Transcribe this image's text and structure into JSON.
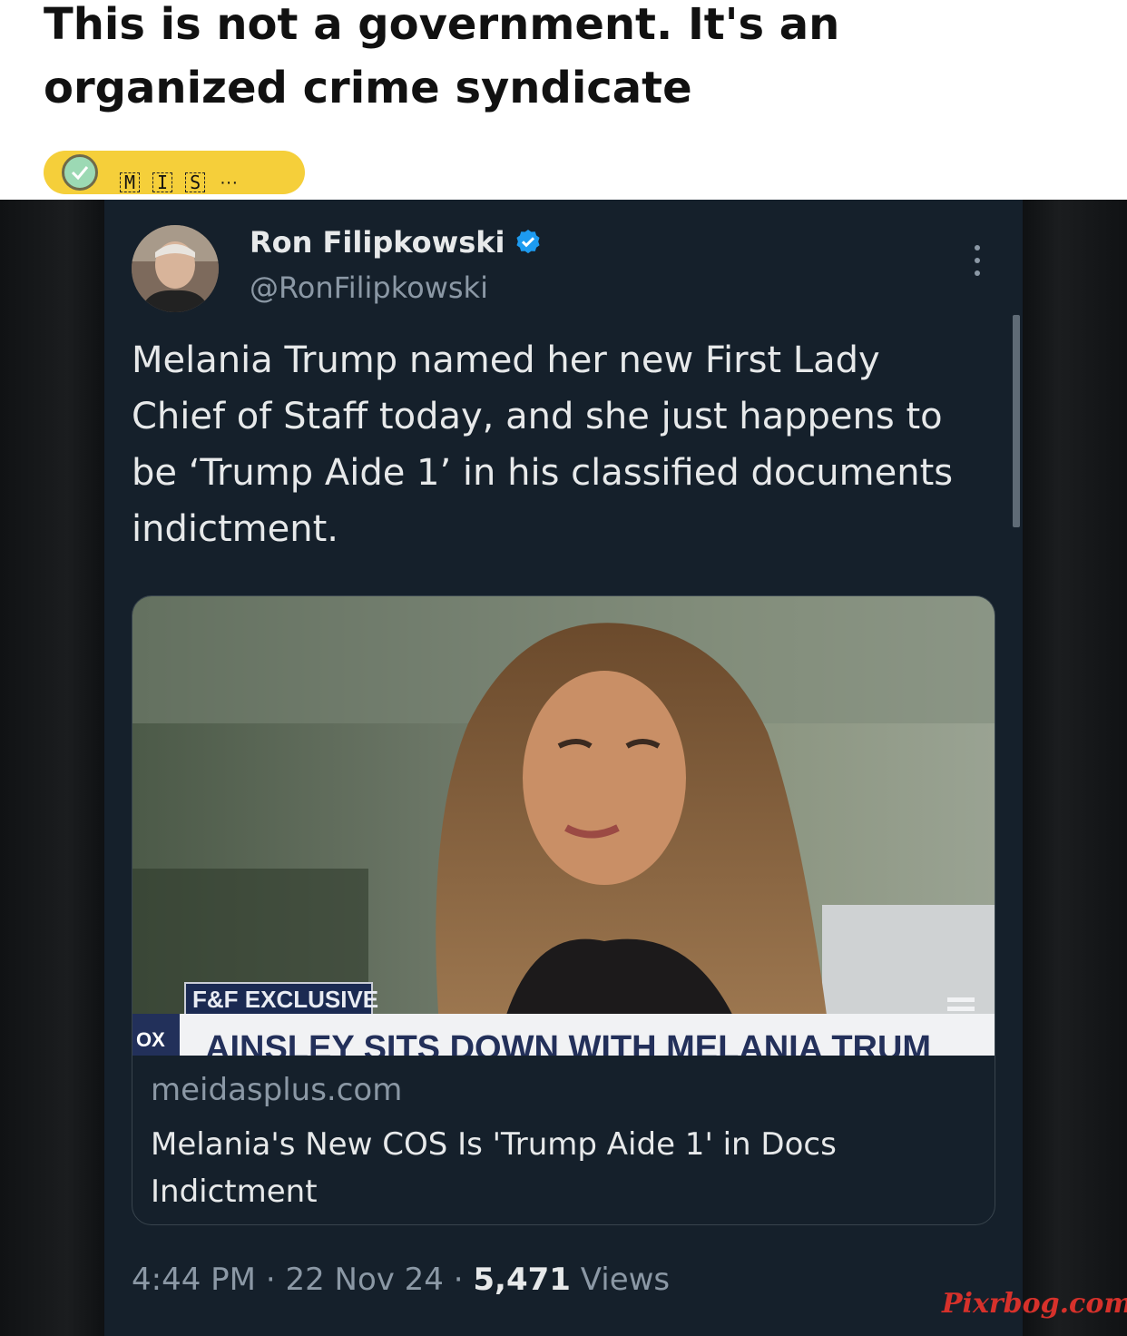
{
  "post": {
    "title": "This is not a government. It's an organized crime syndicate",
    "flair": {
      "letters": [
        "M",
        "I",
        "S"
      ],
      "more": "···",
      "icon": "check-circle-icon"
    }
  },
  "tweet": {
    "author_name": "Ron Filipkowski",
    "handle": "@RonFilipkowski",
    "verified_icon": "verified-badge-icon",
    "text": "Melania Trump named her new First Lady Chief of Staff today, and she just happens to be ‘Trump Aide 1’ in his classified documents indictment.",
    "media": {
      "banner_tag": "F&F EXCLUSIVE",
      "banner_headline": "AINSLEY SITS DOWN WITH MELANIA TRUM",
      "network_logo": "OX",
      "link_domain": "meidasplus.com",
      "link_title": "Melania's New COS Is 'Trump Aide 1' in Docs Indictment"
    },
    "time": "4:44 PM",
    "date": "22 Nov 24",
    "separator": "·",
    "views_count": "5,471",
    "views_label": "Views"
  },
  "watermark": "Pixrbog.com",
  "colors": {
    "card_bg": "#15202b",
    "flair_bg": "#f5cf3a",
    "verified_blue": "#1d9bf0",
    "watermark_red": "#d6312b"
  }
}
